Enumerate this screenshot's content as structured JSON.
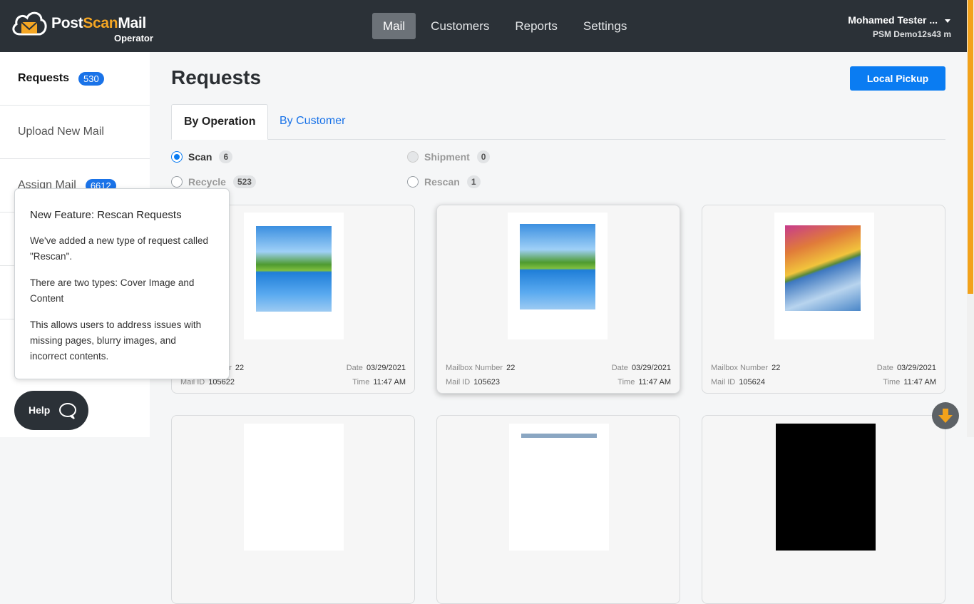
{
  "app": {
    "name_part1": "Post",
    "name_part2": "Scan",
    "name_part3": "Mail",
    "subtitle": "Operator",
    "accent_color": "#f5a623"
  },
  "nav": {
    "items": [
      {
        "label": "Mail",
        "active": true
      },
      {
        "label": "Customers",
        "active": false
      },
      {
        "label": "Reports",
        "active": false
      },
      {
        "label": "Settings",
        "active": false
      }
    ]
  },
  "user": {
    "name": "Mohamed Tester ...",
    "account": "PSM Demo12s43 m"
  },
  "sidebar": {
    "items": [
      {
        "label": "Requests",
        "badge": "530"
      },
      {
        "label": "Upload New Mail",
        "badge": ""
      },
      {
        "label": "Assign Mail",
        "badge": "6612"
      }
    ]
  },
  "popover": {
    "title": "New Feature: Rescan Requests",
    "p1": "We've added a new type of request called \"Rescan\".",
    "p2": "There are two types: Cover Image and Content",
    "p3": "This allows users to address issues with missing pages, blurry images, and incorrect contents."
  },
  "help": {
    "label": "Help"
  },
  "page": {
    "title": "Requests",
    "local_pickup": "Local Pickup",
    "tabs": [
      "By Operation",
      "By Customer"
    ]
  },
  "filters": [
    {
      "label": "Scan",
      "count": "6",
      "state": "selected"
    },
    {
      "label": "Shipment",
      "count": "0",
      "state": "disabled"
    },
    {
      "label": "Recycle",
      "count": "523",
      "state": "unselected"
    },
    {
      "label": "Rescan",
      "count": "1",
      "state": "unselected"
    }
  ],
  "cards": [
    {
      "mailbox_label": "Mailbox Number",
      "mailbox_visible": "ber",
      "mailbox": "22",
      "date_label": "Date",
      "date": "03/29/2021",
      "mailid_label": "Mail ID",
      "mailid": "105622",
      "time_label": "Time",
      "time": "11:47 AM"
    },
    {
      "mailbox_label": "Mailbox Number",
      "mailbox": "22",
      "date_label": "Date",
      "date": "03/29/2021",
      "mailid_label": "Mail ID",
      "mailid": "105623",
      "time_label": "Time",
      "time": "11:47 AM"
    },
    {
      "mailbox_label": "Mailbox Number",
      "mailbox": "22",
      "date_label": "Date",
      "date": "03/29/2021",
      "mailid_label": "Mail ID",
      "mailid": "105624",
      "time_label": "Time",
      "time": "11:47 AM"
    }
  ]
}
